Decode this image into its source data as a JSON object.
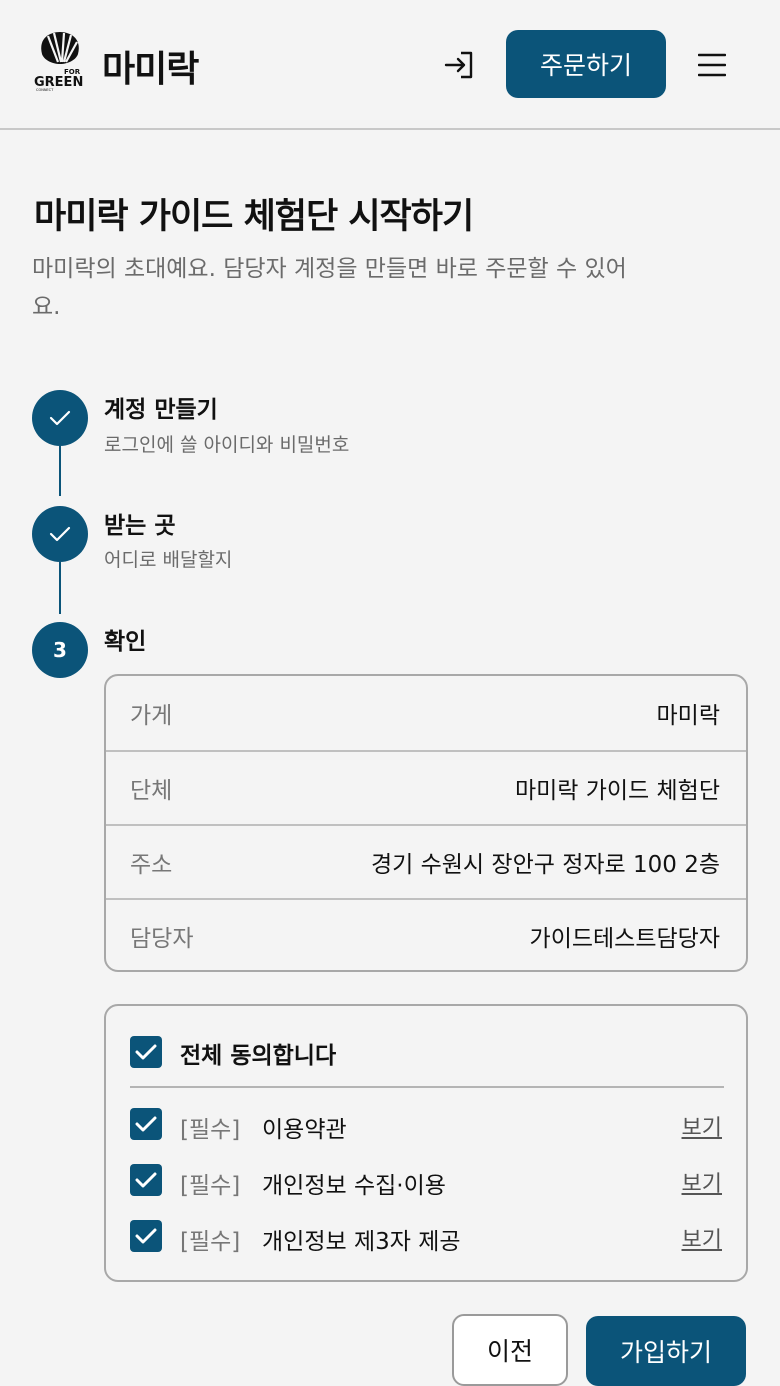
{
  "header": {
    "logo_text": [
      "FOR",
      "GREEN",
      "CONNECT"
    ],
    "brand": "마미락",
    "login_icon": "login-icon",
    "order_label": "주문하기",
    "menu_icon": "hamburger-menu-icon"
  },
  "page": {
    "title": "마미락 가이드 체험단 시작하기",
    "description": "마미락의 초대예요. 담당자 계정을 만들면 바로 주문할 수 있어요."
  },
  "steps": [
    {
      "state": "done",
      "title": "계정 만들기",
      "subtitle": "로그인에 쓸 아이디와 비밀번호"
    },
    {
      "state": "done",
      "title": "받는 곳",
      "subtitle": "어디로 배달할지"
    },
    {
      "state": "current",
      "number": "3",
      "title": "확인"
    }
  ],
  "summary": [
    {
      "label": "가게",
      "value": "마미락"
    },
    {
      "label": "단체",
      "value": "마미락 가이드 체험단"
    },
    {
      "label": "주소",
      "value": "경기 수원시 장안구 정자로 100 2층"
    },
    {
      "label": "담당자",
      "value": "가이드테스트담당자"
    }
  ],
  "agreement": {
    "all_label": "전체 동의합니다",
    "all_checked": true,
    "terms": [
      {
        "tag": "[필수]",
        "label": "이용약관",
        "view": "보기",
        "checked": true
      },
      {
        "tag": "[필수]",
        "label": "개인정보 수집·이용",
        "view": "보기",
        "checked": true
      },
      {
        "tag": "[필수]",
        "label": "개인정보 제3자 제공",
        "view": "보기",
        "checked": true
      }
    ]
  },
  "footer": {
    "prev_label": "이전",
    "signup_label": "가입하기"
  },
  "colors": {
    "accent": "#0b5479",
    "background": "#f4f4f4",
    "muted_text": "#6b6b6b"
  }
}
